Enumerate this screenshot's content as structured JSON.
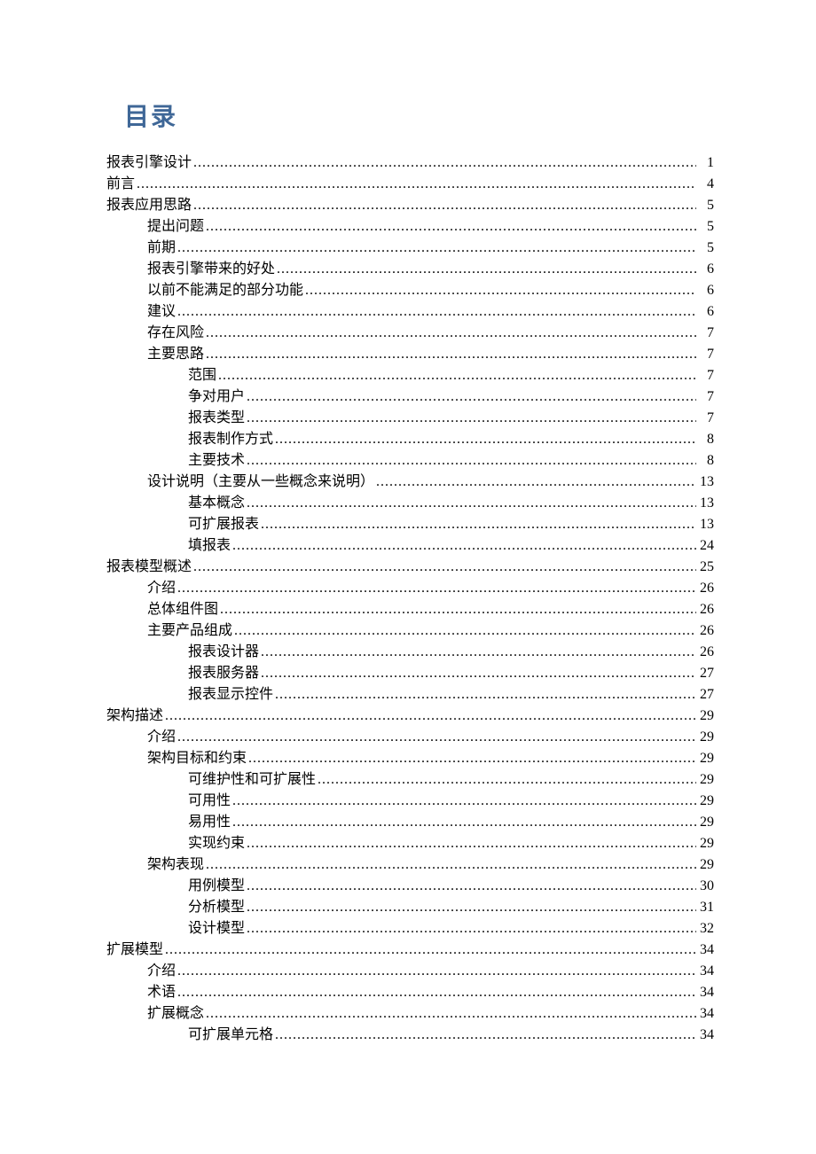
{
  "title": "目录",
  "entries": [
    {
      "label": "报表引擎设计",
      "page": "1",
      "level": 0
    },
    {
      "label": "前言",
      "page": "4",
      "level": 0
    },
    {
      "label": "报表应用思路",
      "page": "5",
      "level": 0
    },
    {
      "label": "提出问题",
      "page": "5",
      "level": 1
    },
    {
      "label": "前期",
      "page": "5",
      "level": 1
    },
    {
      "label": "报表引擎带来的好处",
      "page": "6",
      "level": 1
    },
    {
      "label": "以前不能满足的部分功能",
      "page": "6",
      "level": 1
    },
    {
      "label": "建议",
      "page": "6",
      "level": 1
    },
    {
      "label": "存在风险",
      "page": "7",
      "level": 1
    },
    {
      "label": "主要思路",
      "page": "7",
      "level": 1
    },
    {
      "label": "范围",
      "page": "7",
      "level": 2
    },
    {
      "label": "争对用户",
      "page": "7",
      "level": 2
    },
    {
      "label": "报表类型",
      "page": "7",
      "level": 2
    },
    {
      "label": "报表制作方式",
      "page": "8",
      "level": 2
    },
    {
      "label": "主要技术",
      "page": "8",
      "level": 2
    },
    {
      "label": "设计说明（主要从一些概念来说明）",
      "page": "13",
      "level": 1
    },
    {
      "label": "基本概念",
      "page": "13",
      "level": 2
    },
    {
      "label": "可扩展报表",
      "page": "13",
      "level": 2
    },
    {
      "label": "填报表",
      "page": "24",
      "level": 2
    },
    {
      "label": "报表模型概述",
      "page": "25",
      "level": 0
    },
    {
      "label": "介绍",
      "page": "26",
      "level": 1
    },
    {
      "label": "总体组件图",
      "page": "26",
      "level": 1
    },
    {
      "label": "主要产品组成",
      "page": "26",
      "level": 1
    },
    {
      "label": "报表设计器",
      "page": "26",
      "level": 2
    },
    {
      "label": "报表服务器",
      "page": "27",
      "level": 2
    },
    {
      "label": "报表显示控件",
      "page": "27",
      "level": 2
    },
    {
      "label": "架构描述",
      "page": "29",
      "level": 0
    },
    {
      "label": "介绍",
      "page": "29",
      "level": 1
    },
    {
      "label": "架构目标和约束",
      "page": "29",
      "level": 1
    },
    {
      "label": "可维护性和可扩展性",
      "page": "29",
      "level": 2
    },
    {
      "label": "可用性",
      "page": "29",
      "level": 2
    },
    {
      "label": "易用性",
      "page": "29",
      "level": 2
    },
    {
      "label": "实现约束",
      "page": "29",
      "level": 2
    },
    {
      "label": "架构表现",
      "page": "29",
      "level": 1
    },
    {
      "label": "用例模型",
      "page": "30",
      "level": 2
    },
    {
      "label": "分析模型",
      "page": "31",
      "level": 2
    },
    {
      "label": "设计模型",
      "page": "32",
      "level": 2
    },
    {
      "label": "扩展模型",
      "page": "34",
      "level": 0
    },
    {
      "label": "介绍",
      "page": "34",
      "level": 1
    },
    {
      "label": "术语",
      "page": "34",
      "level": 1
    },
    {
      "label": "扩展概念",
      "page": "34",
      "level": 1
    },
    {
      "label": "可扩展单元格",
      "page": "34",
      "level": 2
    }
  ]
}
